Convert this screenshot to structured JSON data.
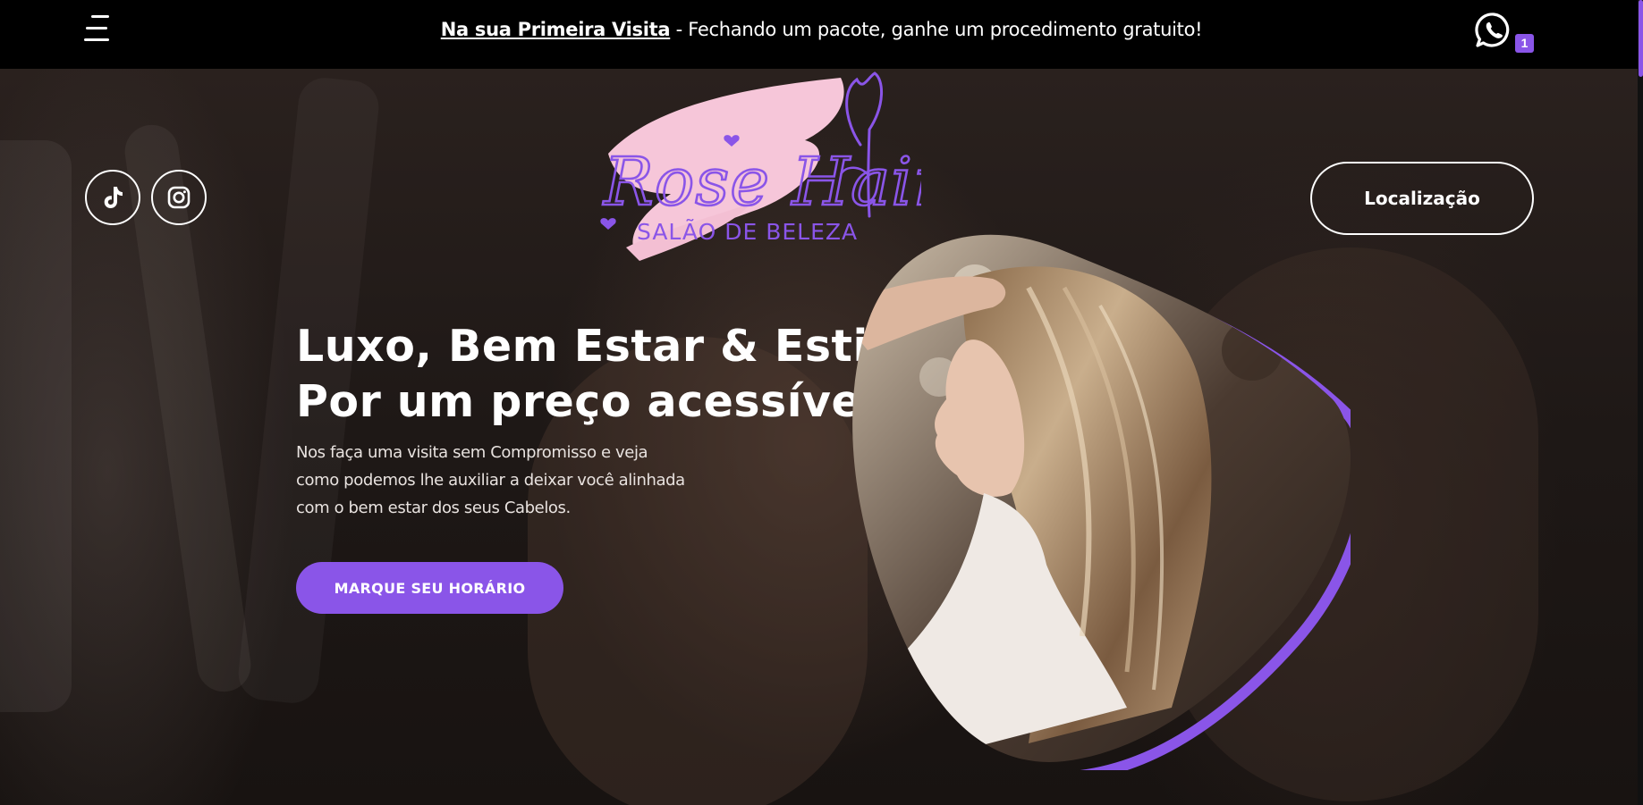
{
  "topbar": {
    "promo_link": "Na sua Primeira Visita",
    "promo_text": " - Fechando um pacote, ganhe um procedimento gratuito!",
    "whatsapp_count": "1"
  },
  "hero": {
    "location_label": "Localização",
    "logo": {
      "name": "Rose Hair",
      "tagline": "SALÃO DE BELEZA"
    },
    "headline_line1": "Luxo, Bem Estar & Estilo",
    "headline_line2": "Por um preço acessível",
    "subtitle": "Nos faça uma visita sem Compromisso e veja como podemos lhe auxiliar a deixar você alinhada com o bem estar dos seus Cabelos.",
    "cta_label": "MARQUE SEU HORÁRIO"
  },
  "icons": [
    "menu-icon",
    "whatsapp-icon",
    "tiktok-icon",
    "instagram-icon"
  ],
  "colors": {
    "accent": "#8a55e8",
    "logo_pink": "#f6c6d9",
    "logo_purple": "#8a55e8",
    "topbar": "#000000"
  }
}
